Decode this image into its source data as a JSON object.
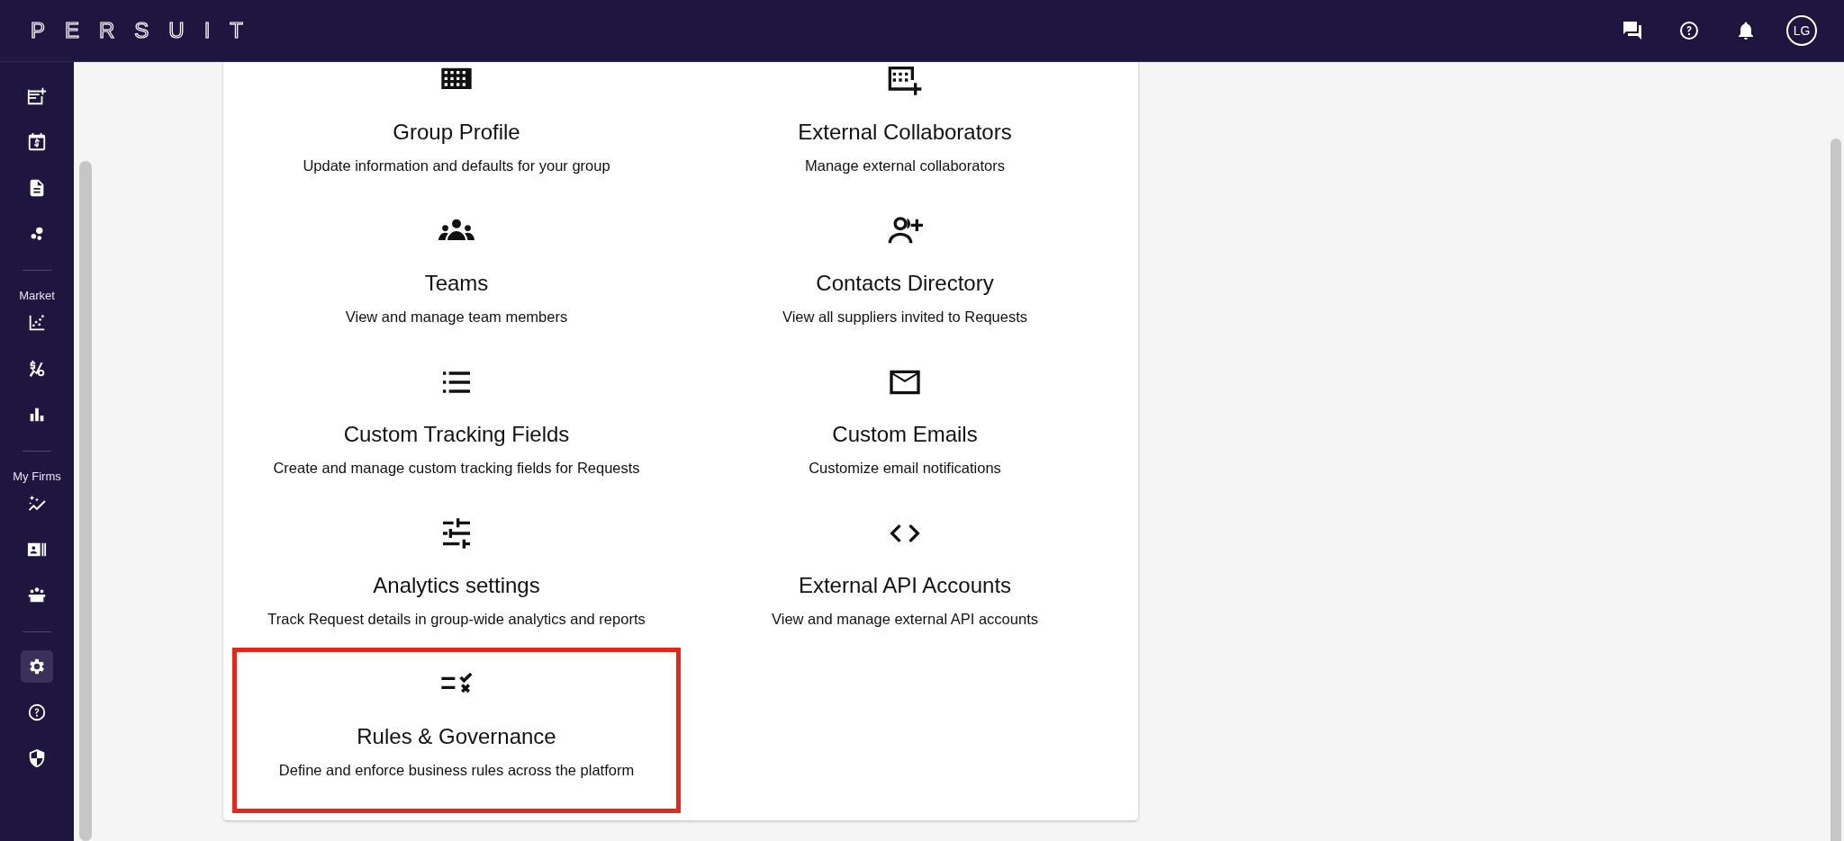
{
  "top_bar": {
    "logo": "PERSUIT",
    "avatar": "LG"
  },
  "sidebar": {
    "groups": [
      {
        "items": [
          {
            "selected": false
          },
          {
            "selected": false
          },
          {
            "selected": false
          },
          {
            "selected": false
          }
        ]
      },
      {
        "label": "Market",
        "items": [
          {
            "selected": false
          },
          {
            "selected": false
          },
          {
            "selected": false
          }
        ]
      },
      {
        "label": "My Firms",
        "items": [
          {
            "selected": false
          },
          {
            "selected": false
          },
          {
            "selected": false
          }
        ]
      },
      {
        "items": [
          {
            "selected": true
          },
          {
            "selected": false
          },
          {
            "selected": false
          }
        ]
      }
    ]
  },
  "settings": [
    {
      "title": "Group Profile",
      "description": "Update information and defaults for your group",
      "highlighted": false
    },
    {
      "title": "External Collaborators",
      "description": "Manage external collaborators",
      "highlighted": false
    },
    {
      "title": "Teams",
      "description": "View and manage team members",
      "highlighted": false
    },
    {
      "title": "Contacts Directory",
      "description": "View all suppliers invited to Requests",
      "highlighted": false
    },
    {
      "title": "Custom Tracking Fields",
      "description": "Create and manage custom tracking fields for Requests",
      "highlighted": false
    },
    {
      "title": "Custom Emails",
      "description": "Customize email notifications",
      "highlighted": false
    },
    {
      "title": "Analytics settings",
      "description": "Track Request details in group-wide analytics and reports",
      "highlighted": false
    },
    {
      "title": "External API Accounts",
      "description": "View and manage external API accounts",
      "highlighted": false
    },
    {
      "title": "Rules & Governance",
      "description": "Define and enforce business rules across the platform",
      "highlighted": true
    }
  ]
}
